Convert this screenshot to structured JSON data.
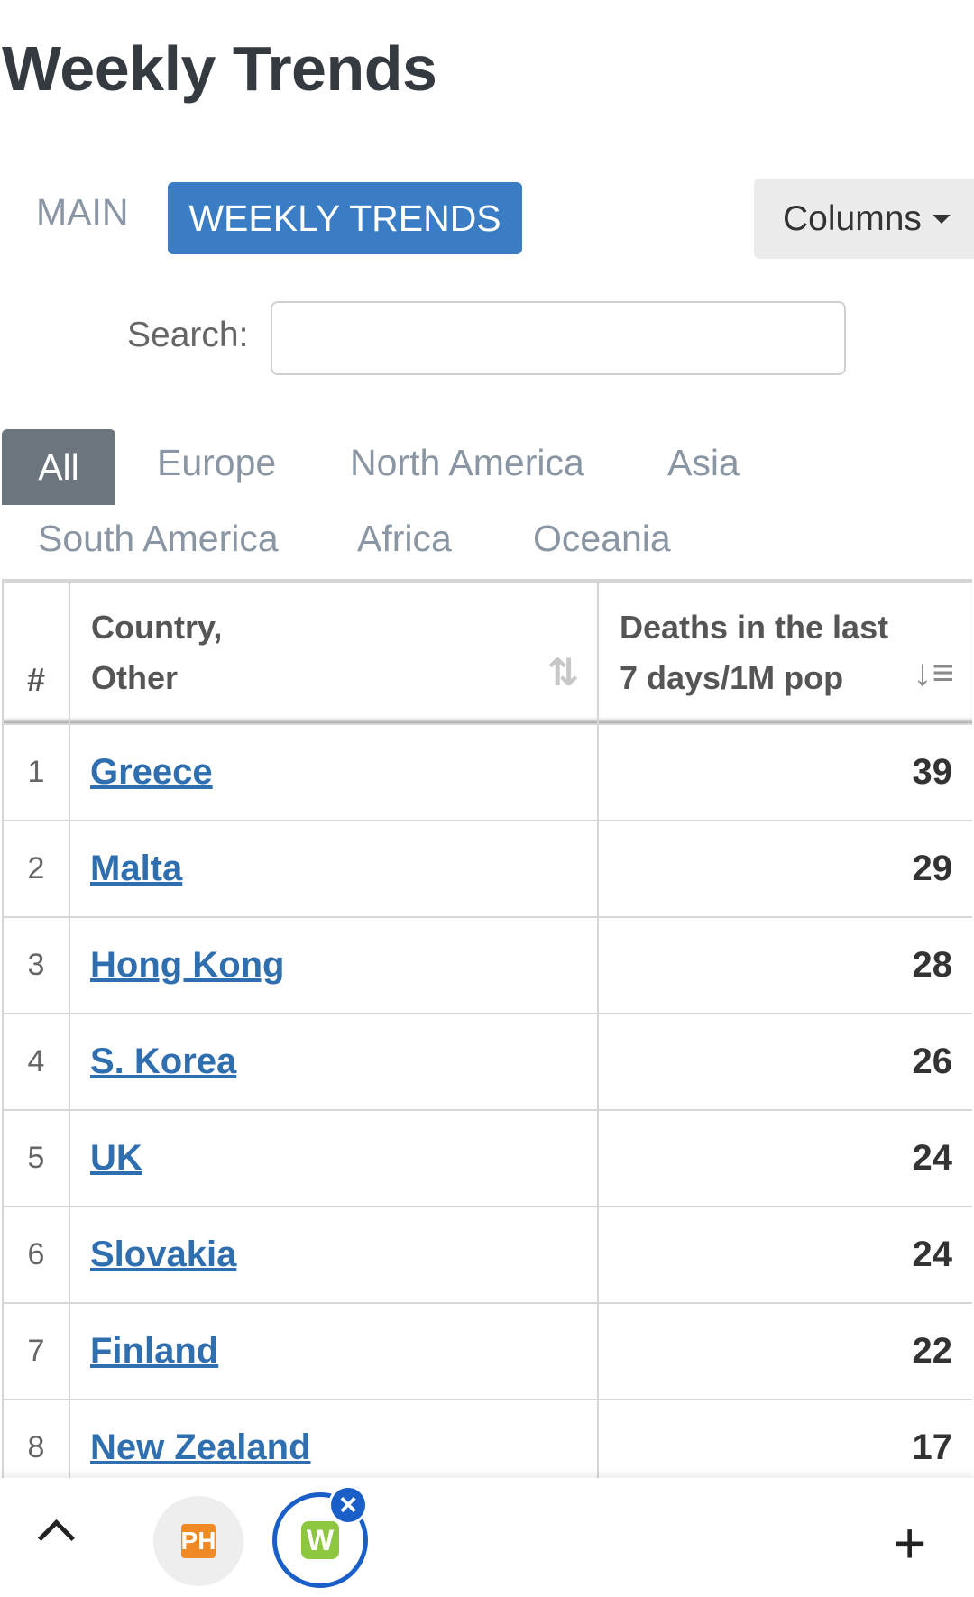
{
  "header": {
    "title": "Weekly Trends"
  },
  "tabs": {
    "main": "MAIN",
    "weekly": "WEEKLY TRENDS"
  },
  "columns_button": {
    "label": "Columns"
  },
  "search": {
    "label": "Search:",
    "value": ""
  },
  "regions": [
    "All",
    "Europe",
    "North America",
    "Asia",
    "South America",
    "Africa",
    "Oceania"
  ],
  "table": {
    "headers": {
      "num": "#",
      "country_line1": "Country,",
      "country_line2": "Other",
      "deaths_line1": "Deaths in the last",
      "deaths_line2": "7 days/1M pop"
    },
    "rows": [
      {
        "num": "1",
        "country": "Greece",
        "value": "39"
      },
      {
        "num": "2",
        "country": "Malta",
        "value": "29"
      },
      {
        "num": "3",
        "country": "Hong Kong",
        "value": "28"
      },
      {
        "num": "4",
        "country": "S. Korea",
        "value": "26"
      },
      {
        "num": "5",
        "country": "UK",
        "value": "24"
      },
      {
        "num": "6",
        "country": "Slovakia",
        "value": "24"
      },
      {
        "num": "7",
        "country": "Finland",
        "value": "22"
      },
      {
        "num": "8",
        "country": "New Zealand",
        "value": "17"
      }
    ]
  },
  "bottom_bar": {
    "tab1_logo": "PH",
    "tab2_logo": "W",
    "close": "×",
    "plus": "+"
  },
  "colors": {
    "accent": "#3a7dc4",
    "link": "#2f6fb0",
    "active_region": "#6c757d"
  }
}
